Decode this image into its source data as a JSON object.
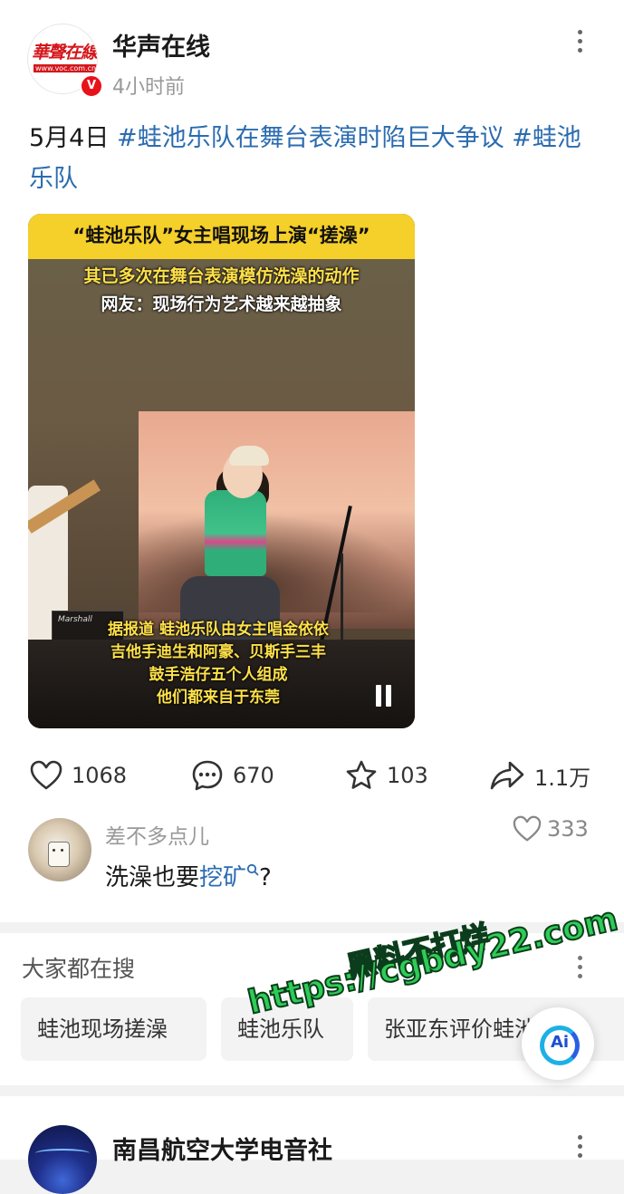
{
  "post": {
    "author": "华声在线",
    "avatar_text": "華聲在線",
    "avatar_url": "www.voc.com.cn",
    "verified_badge": "V",
    "time": "4小时前",
    "content_prefix": "5月4日 ",
    "tag1": "#蛙池乐队在舞台表演时陷巨大争议",
    "tag2": " #蛙池乐队",
    "media": {
      "banner": "“蛙池乐队”女主唱现场上演“搓澡”",
      "overlay1": "其已多次在舞台表演模仿洗澡的动作",
      "overlay2": "网友：现场行为艺术越来越抽象",
      "subtitles": [
        "据报道 蛙池乐队由女主唱金依依",
        "吉他手迪生和阿豪、贝斯手三丰",
        "鼓手浩仔五个人组成",
        "他们都来自于东莞"
      ],
      "amp_brand": "Marshall"
    },
    "actions": {
      "likes": "1068",
      "comments": "670",
      "favorites": "103",
      "shares": "1.1万"
    }
  },
  "comment": {
    "user": "差不多点儿",
    "likes": "333",
    "text_prefix": "洗澡也要",
    "link": "挖矿"
  },
  "search": {
    "title": "大家都在搜",
    "chips": [
      "蛙池现场搓澡",
      "蛙池乐队",
      "张亚东评价蛙池乐队"
    ]
  },
  "next_post": {
    "author": "南昌航空大学电音社"
  },
  "watermark": {
    "line1": "黑料不打烊",
    "line2": "https://cgbdy22.com"
  },
  "ai_button": {
    "label": "Ai"
  },
  "colors": {
    "link": "#2b6cb0",
    "banner": "#f5cf2a",
    "subtitle": "#ffe14a",
    "verified": "#e8121a"
  }
}
